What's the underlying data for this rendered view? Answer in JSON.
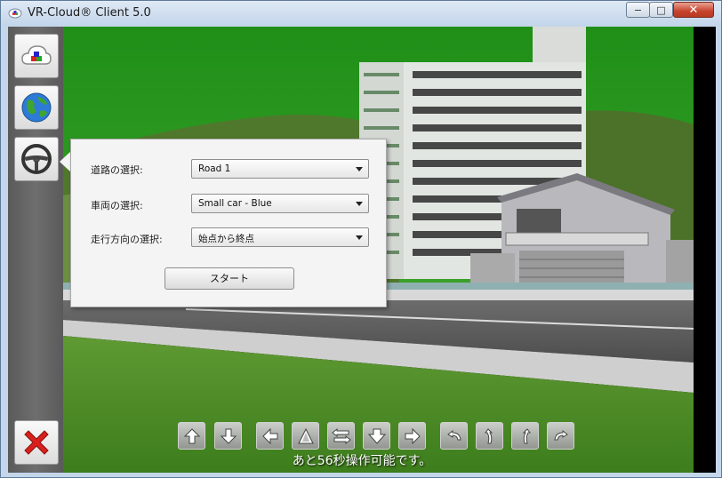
{
  "window": {
    "title": "VR-Cloud® Client 5.0",
    "minimize_label": "−",
    "maximize_label": "□",
    "close_label": "✕"
  },
  "sidebar": {
    "buttons": [
      {
        "name": "cloud-icon"
      },
      {
        "name": "globe-icon"
      },
      {
        "name": "steering-wheel-icon"
      }
    ],
    "exit_icon": "red-x-icon"
  },
  "drive_panel": {
    "road_label": "道路の選択:",
    "road_value": "Road 1",
    "vehicle_label": "車両の選択:",
    "vehicle_value": "Small car - Blue",
    "direction_label": "走行方向の選択:",
    "direction_value": "始点から終点",
    "start_label": "スタート"
  },
  "controls": [
    {
      "name": "arrow-up-icon"
    },
    {
      "name": "arrow-down-icon"
    },
    {
      "name": "arrow-left-icon"
    },
    {
      "name": "move-forward-icon"
    },
    {
      "name": "swap-horizontal-icon"
    },
    {
      "name": "move-down-icon"
    },
    {
      "name": "arrow-right-icon"
    },
    {
      "name": "turn-back-left-icon"
    },
    {
      "name": "curve-left-icon"
    },
    {
      "name": "curve-right-icon"
    },
    {
      "name": "turn-back-right-icon"
    }
  ],
  "status": {
    "text": "あと56秒操作可能です。"
  },
  "colors": {
    "sky": "#2e9a1e",
    "hill": "#4f7a2c",
    "road": "#5b5b5b",
    "grass": "#4a8a22",
    "exit_red": "#d8201c"
  }
}
